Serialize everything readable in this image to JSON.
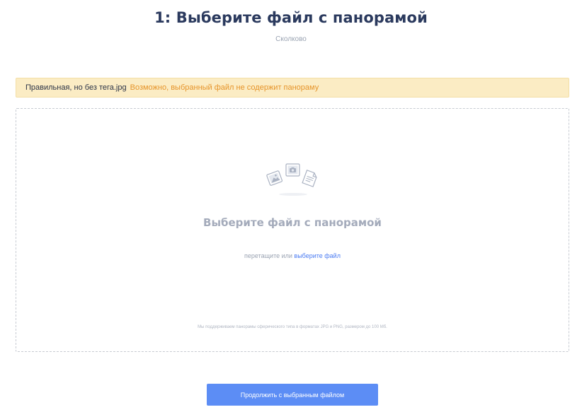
{
  "header": {
    "title": "1: Выберите файл с панорамой",
    "subtitle": "Сколково"
  },
  "warning": {
    "file_name": "Правильная, но без тега.jpg",
    "message": "Возможно, выбранный файл не содержит панораму",
    "background_color": "#fbecc4",
    "message_color": "#e6942a"
  },
  "dropzone": {
    "icons": [
      "image-icon",
      "camera-icon",
      "document-icon"
    ],
    "title": "Выберите файл с панорамой",
    "hint_prefix": "перетащите или ",
    "hint_link": "выберите файл",
    "note": "Мы поддерживаем панорамы сферического типа в форматах JPG и PNG, размером до 100 Мб."
  },
  "actions": {
    "continue_label": "Продолжить с выбранным файлом",
    "accent_color": "#5c8df5"
  }
}
